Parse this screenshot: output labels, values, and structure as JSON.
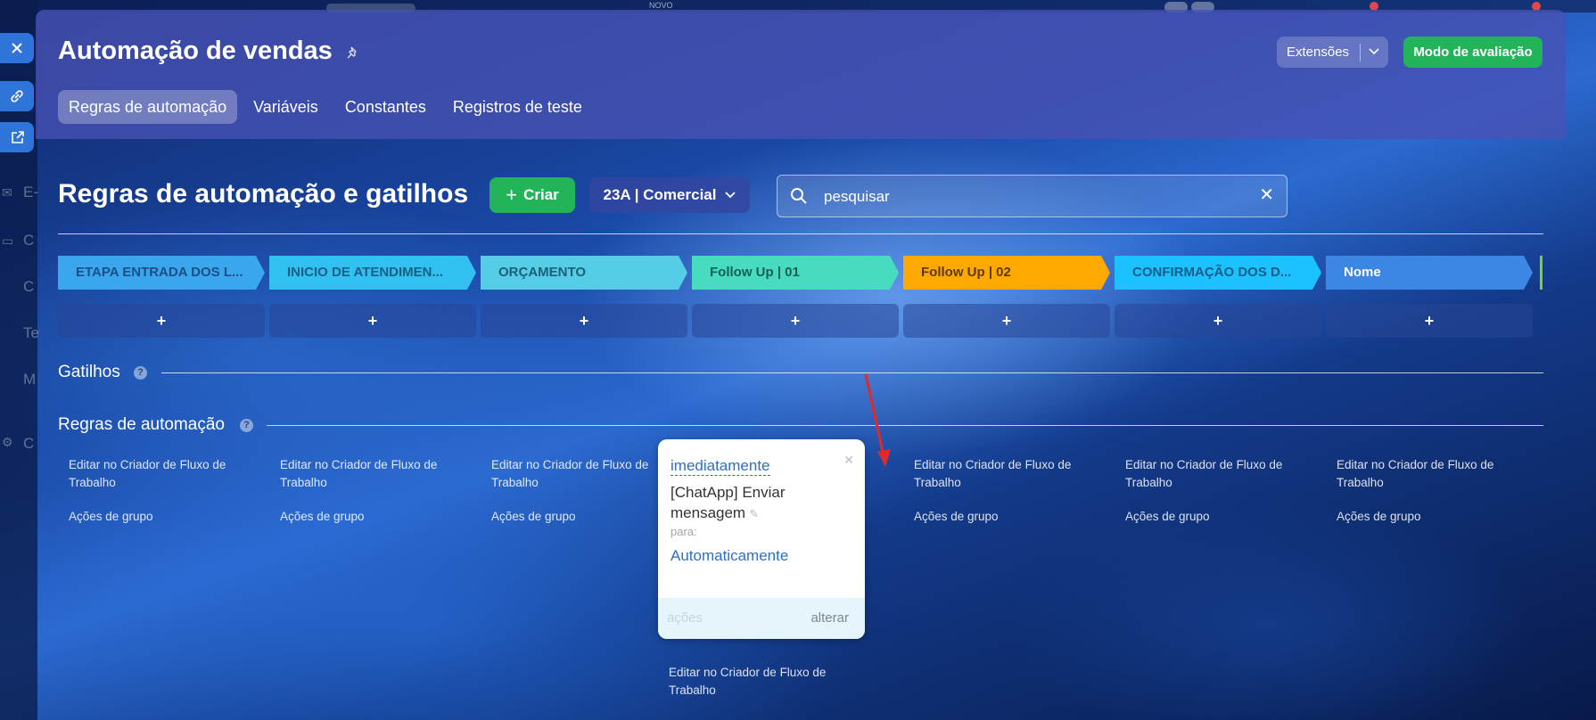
{
  "background_behind": {
    "novo_label": "NOVO",
    "left_items": [
      "E-",
      "C",
      "C",
      "Te",
      "M",
      "C"
    ]
  },
  "header": {
    "title": "Automação de vendas",
    "extensions_label": "Extensões",
    "eval_mode_label": "Modo de avaliação",
    "tabs": [
      {
        "label": "Regras de automação",
        "active": true
      },
      {
        "label": "Variáveis",
        "active": false
      },
      {
        "label": "Constantes",
        "active": false
      },
      {
        "label": "Registros de teste",
        "active": false
      }
    ]
  },
  "toolbar": {
    "heading": "Regras de automação e gatilhos",
    "create_label": "Criar",
    "pipeline_label": "23A | Comercial",
    "search_placeholder": "pesquisar"
  },
  "stages": [
    {
      "label": "ETAPA ENTRADA DOS L...",
      "color": "#3aa6ee",
      "text_color": "#1c4f86"
    },
    {
      "label": "INICIO DE ATENDIMEN...",
      "color": "#31c0ef",
      "text_color": "#1a5f85"
    },
    {
      "label": "ORÇAMENTO",
      "color": "#55cde6",
      "text_color": "#1d5f78"
    },
    {
      "label": "Follow Up | 01",
      "color": "#47dcc0",
      "text_color": "#185e55"
    },
    {
      "label": "Follow Up | 02",
      "color": "#ffa900",
      "text_color": "#5c3a00"
    },
    {
      "label": "CONFIRMAÇÃO DOS D...",
      "color": "#1cc2ff",
      "text_color": "#165e86"
    },
    {
      "label": "Nome",
      "color": "#3c86e4",
      "text_color": "#ffffff"
    }
  ],
  "add_label": "+",
  "triggers_section": {
    "title": "Gatilhos",
    "help": "?"
  },
  "rules_section": {
    "title": "Regras de automação",
    "help": "?",
    "edit_label": "Editar no Criador de Fluxo de Trabalho",
    "group_label": "Ações de grupo"
  },
  "rule_card": {
    "timing": "imediatamente",
    "action": "[ChatApp] Enviar mensagem",
    "to_label": "para:",
    "recipient": "Automaticamente",
    "actions_label": "ações",
    "change_label": "alterar"
  },
  "colors": {
    "accent_green": "#23b359",
    "link_blue": "#2f6ec0",
    "arrow_red": "#e02a2a"
  }
}
